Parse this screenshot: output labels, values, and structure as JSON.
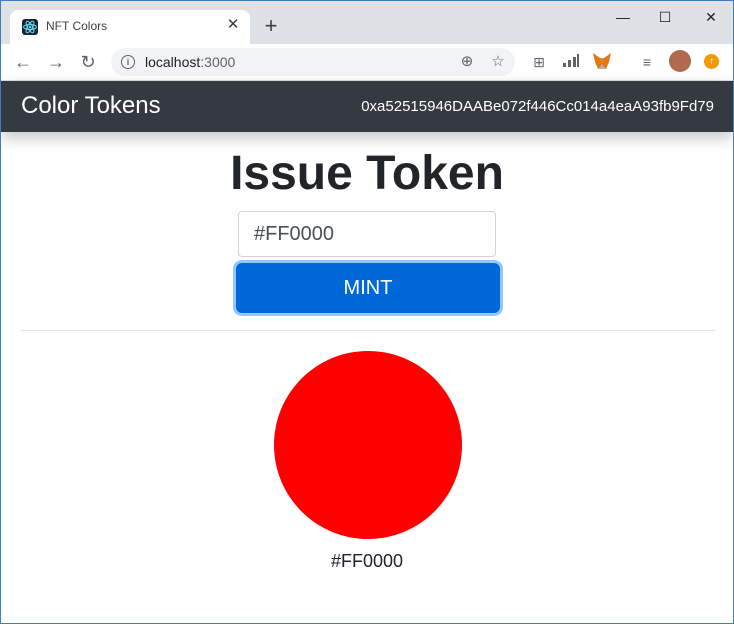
{
  "browser": {
    "tab_title": "NFT Colors",
    "tab_close": "✕",
    "new_tab": "+",
    "url_host": "localhost",
    "url_port": ":3000",
    "window_controls": {
      "minimize": "—",
      "maximize": "☐",
      "close": "✕"
    }
  },
  "navbar": {
    "brand": "Color Tokens",
    "account": "0xa52515946DAABe072f446Cc014a4eaA93fb9Fd79"
  },
  "main": {
    "title": "Issue Token",
    "input_value": "#FF0000",
    "mint_label": "MINT"
  },
  "tokens": [
    {
      "color": "#FF0000",
      "label": "#FF0000"
    }
  ]
}
